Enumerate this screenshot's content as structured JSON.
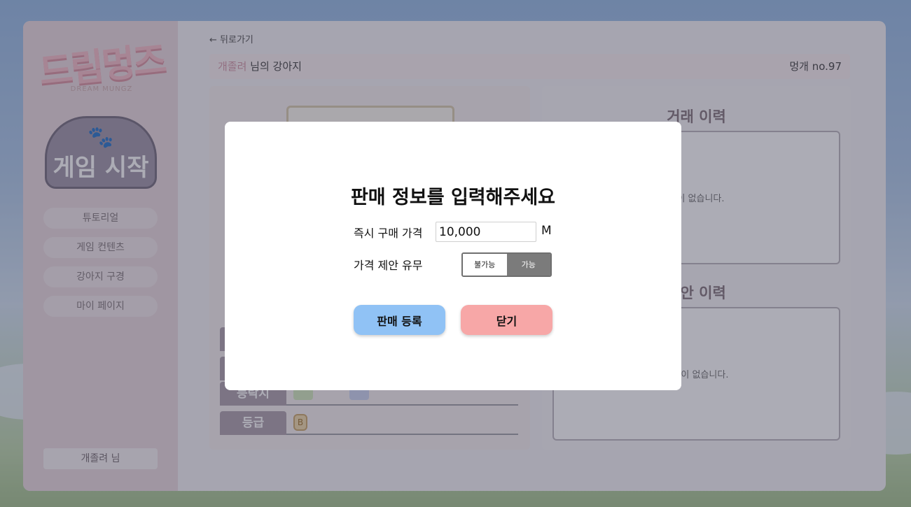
{
  "sidebar": {
    "logo_text": "드림멍즈",
    "logo_sub": "DREAM MUNGZ",
    "start_label": "게임 시작",
    "items": [
      {
        "label": "튜토리얼"
      },
      {
        "label": "게임 컨텐츠"
      },
      {
        "label": "강아지 구경"
      },
      {
        "label": "마이 페이지"
      }
    ],
    "user": "개졸려 님"
  },
  "main": {
    "back_label": "← 뒤로가기",
    "owner": "개졸려",
    "owner_suffix": " 님의 강아지",
    "dog_no": "멍개 no.97",
    "stats": [
      {
        "label": "등락지"
      },
      {
        "label": "등급",
        "grade": "B"
      }
    ],
    "history": {
      "trade_title": "거래 이력",
      "trade_empty": "역이 없습니다.",
      "offer_title": "제안 이력",
      "offer_empty": "내역이 없습니다."
    }
  },
  "modal": {
    "title": "판매 정보를 입력해주세요",
    "price_label": "즉시 구매 가격",
    "price_value": "10,000",
    "price_unit": "M",
    "offer_label": "가격 제안 유무",
    "toggle_off": "불가능",
    "toggle_on": "가능",
    "register_label": "판매 등록",
    "close_label": "닫기"
  },
  "colors": {
    "register_button": "#90c2f5",
    "close_button": "#f7a7a7",
    "toggle_selected": "#7b7b7b"
  }
}
